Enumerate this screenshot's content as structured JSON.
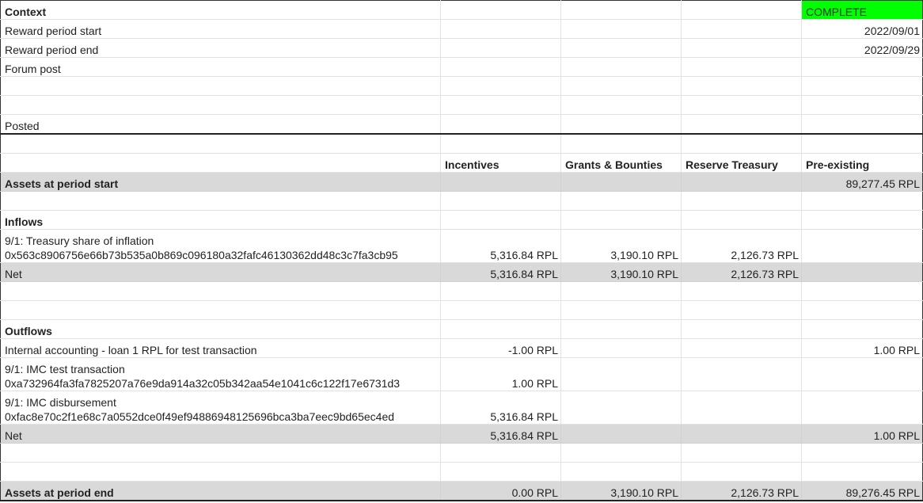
{
  "context": {
    "title": "Context",
    "status": "COMPLETE",
    "status_color": "#00ff00",
    "rows": [
      {
        "label": "Reward period start",
        "value": "2022/09/01"
      },
      {
        "label": "Reward period end",
        "value": "2022/09/29"
      },
      {
        "label": "Forum post",
        "value": ""
      },
      {
        "label": "",
        "value": ""
      },
      {
        "label": "",
        "value": ""
      },
      {
        "label": "Posted",
        "value": ""
      }
    ]
  },
  "columns": [
    "Incentives",
    "Grants & Bounties",
    "Reserve Treasury",
    "Pre-existing"
  ],
  "assets_start": {
    "label": "Assets at period start",
    "values": [
      "",
      "",
      "",
      "89,277.45 RPL"
    ]
  },
  "inflows": {
    "title": "Inflows",
    "items": [
      {
        "line1": "9/1: Treasury share of inflation",
        "line2": "0x563c8906756e66b73b535a0b869c096180a32fafc46130362dd48c3c7fa3cb95",
        "values": [
          "5,316.84 RPL",
          "3,190.10 RPL",
          "2,126.73 RPL",
          ""
        ]
      }
    ],
    "net": {
      "label": "Net",
      "values": [
        "5,316.84 RPL",
        "3,190.10 RPL",
        "2,126.73 RPL",
        ""
      ]
    }
  },
  "outflows": {
    "title": "Outflows",
    "internal": {
      "label": "Internal accounting - loan 1 RPL for test transaction",
      "values": [
        "-1.00 RPL",
        "",
        "",
        "1.00 RPL"
      ]
    },
    "items": [
      {
        "line1": "9/1: IMC test transaction",
        "line2": "0xa732964fa3fa7825207a76e9da914a32c05b342aa54e1041c6c122f17e6731d3",
        "values": [
          "1.00 RPL",
          "",
          "",
          ""
        ]
      },
      {
        "line1": "9/1: IMC disbursement",
        "line2": "0xfac8e70c2f1e68c7a0552dce0f49ef94886948125696bca3ba7eec9bd65ec4ed",
        "values": [
          "5,316.84 RPL",
          "",
          "",
          ""
        ]
      }
    ],
    "net": {
      "label": "Net",
      "values": [
        "5,316.84 RPL",
        "",
        "",
        "1.00 RPL"
      ]
    }
  },
  "assets_end": {
    "label": "Assets at period end",
    "values": [
      "0.00 RPL",
      "3,190.10 RPL",
      "2,126.73 RPL",
      "89,276.45 RPL"
    ]
  }
}
